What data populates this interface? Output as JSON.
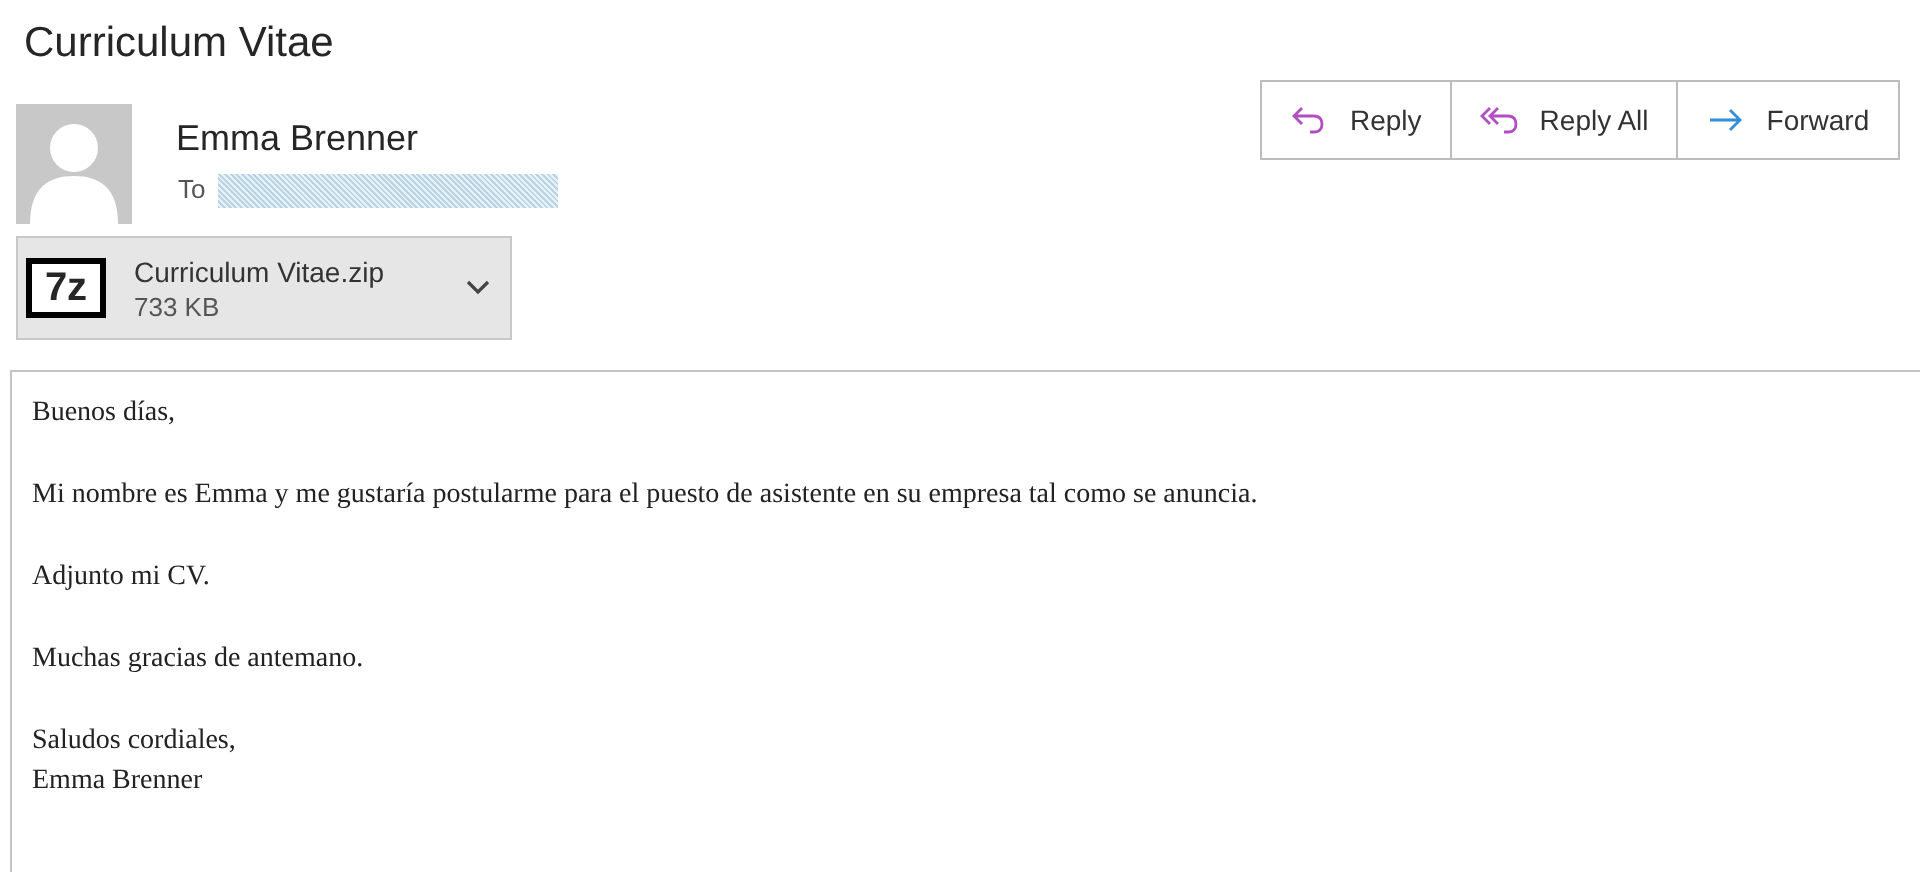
{
  "subject": "Curriculum Vitae",
  "sender": {
    "name": "Emma Brenner",
    "to_label": "To"
  },
  "attachment": {
    "file_name": "Curriculum Vitae.zip",
    "size": "733 KB",
    "icon_text": "7z"
  },
  "actions": [
    {
      "kind": "reply",
      "label": "Reply"
    },
    {
      "kind": "reply_all",
      "label": "Reply All"
    },
    {
      "kind": "forward",
      "label": "Forward"
    }
  ],
  "body": [
    [
      "Buenos días,"
    ],
    [
      "Mi nombre es Emma y me gustaría postularme para el puesto de asistente en su empresa tal como se anuncia."
    ],
    [
      "Adjunto mi CV."
    ],
    [
      "Muchas gracias de antemano."
    ],
    [
      "Saludos cordiales,",
      "Emma Brenner"
    ]
  ]
}
